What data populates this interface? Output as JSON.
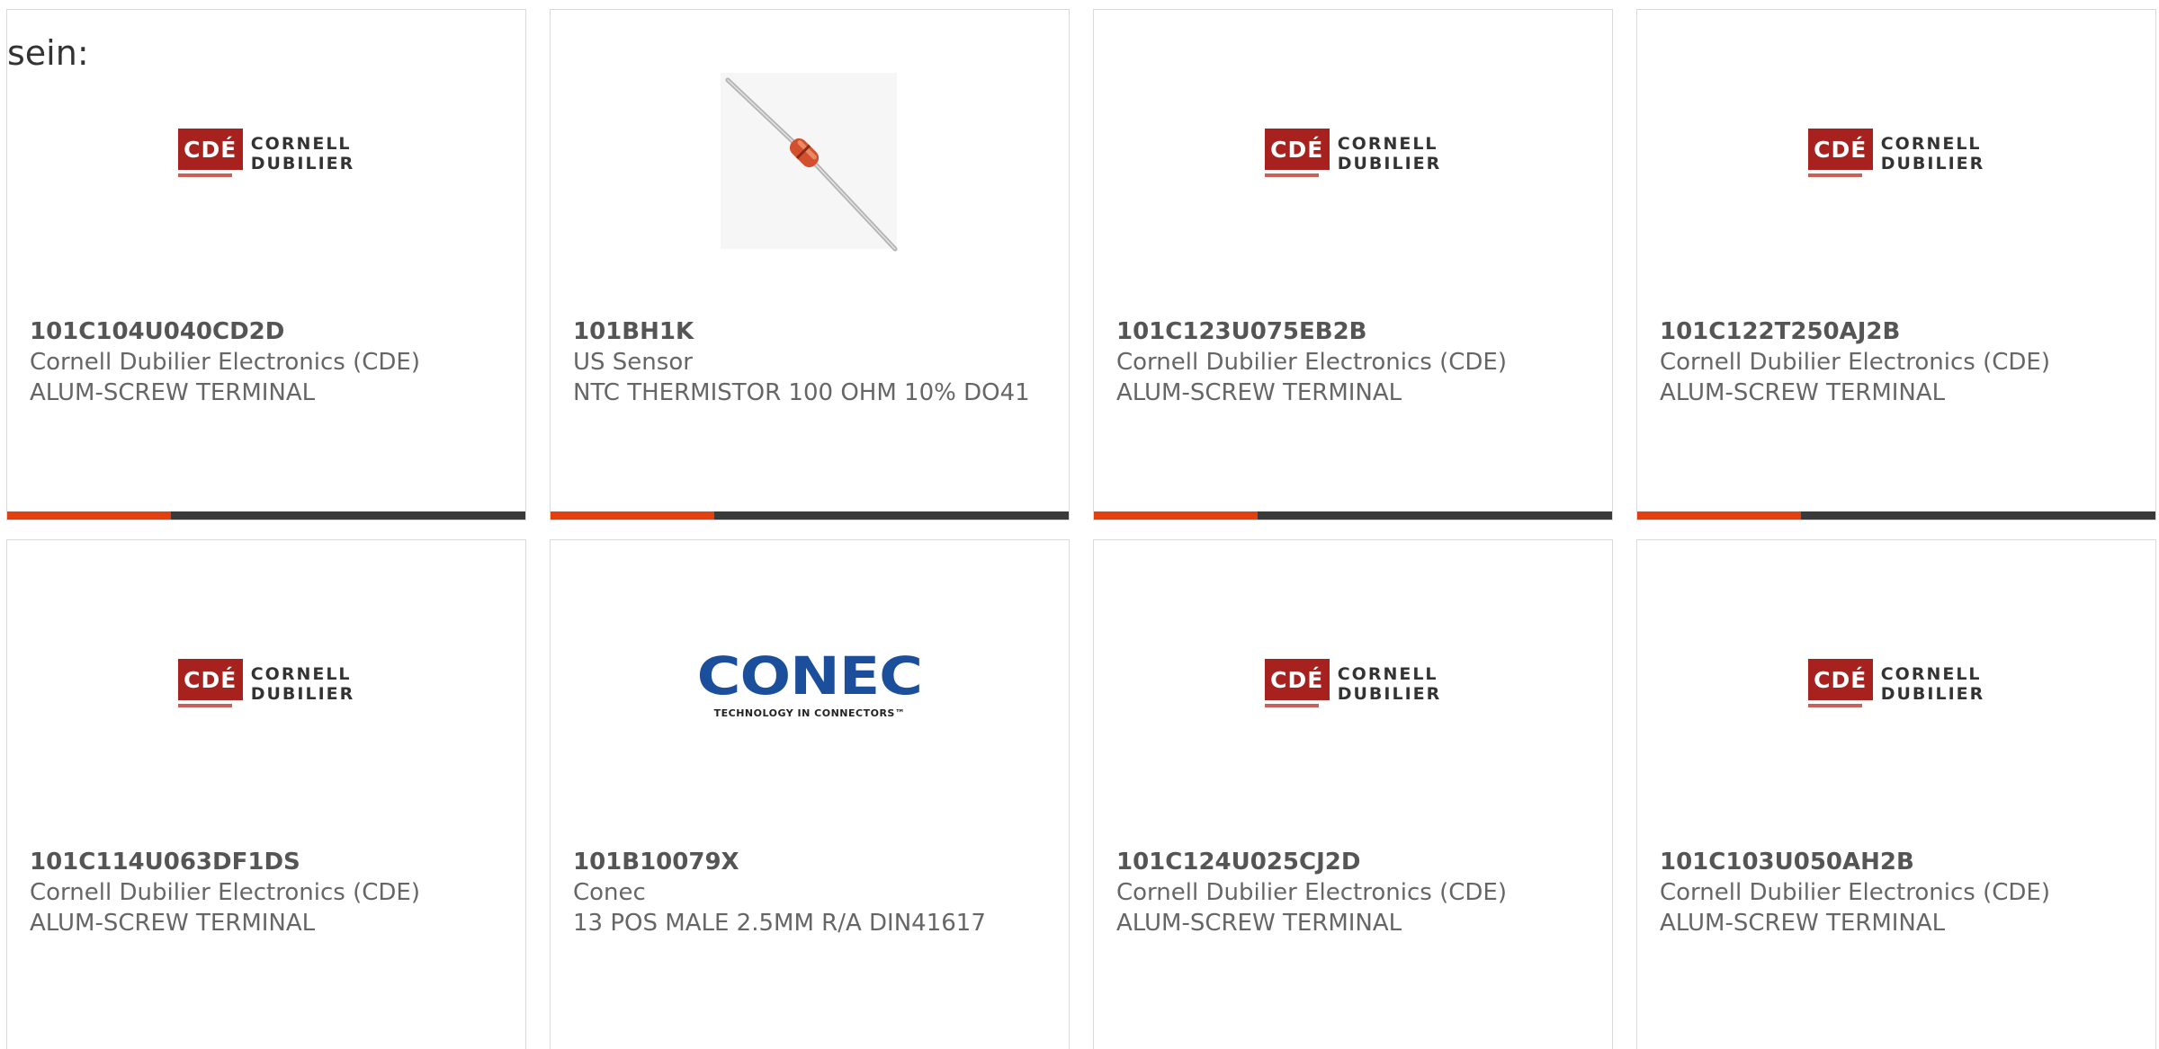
{
  "intro_text": "sein:",
  "logos": {
    "cde": {
      "mark": "CDÉ",
      "line1": "CORNELL",
      "line2": "DUBILIER",
      "color": "#a7211e"
    },
    "conec": {
      "word": "CONEC",
      "tagline": "TECHNOLOGY IN CONNECTORS™",
      "color": "#1b4f9c"
    }
  },
  "colors": {
    "accent": "#e3400f",
    "bar": "#3a3a3a"
  },
  "products": [
    {
      "part_number": "101C104U040CD2D",
      "manufacturer": "Cornell Dubilier Electronics (CDE)",
      "description": "ALUM-SCREW TERMINAL",
      "image": "cornell-dubilier-logo"
    },
    {
      "part_number": "101BH1K",
      "manufacturer": "US Sensor",
      "description": "NTC THERMISTOR 100 OHM 10% DO41",
      "image": "thermistor-photo"
    },
    {
      "part_number": "101C123U075EB2B",
      "manufacturer": "Cornell Dubilier Electronics (CDE)",
      "description": "ALUM-SCREW TERMINAL",
      "image": "cornell-dubilier-logo"
    },
    {
      "part_number": "101C122T250AJ2B",
      "manufacturer": "Cornell Dubilier Electronics (CDE)",
      "description": "ALUM-SCREW TERMINAL",
      "image": "cornell-dubilier-logo"
    },
    {
      "part_number": "101C114U063DF1DS",
      "manufacturer": "Cornell Dubilier Electronics (CDE)",
      "description": "ALUM-SCREW TERMINAL",
      "image": "cornell-dubilier-logo"
    },
    {
      "part_number": "101B10079X",
      "manufacturer": "Conec",
      "description": "13 POS MALE 2.5MM R/A DIN41617",
      "image": "conec-logo"
    },
    {
      "part_number": "101C124U025CJ2D",
      "manufacturer": "Cornell Dubilier Electronics (CDE)",
      "description": "ALUM-SCREW TERMINAL",
      "image": "cornell-dubilier-logo"
    },
    {
      "part_number": "101C103U050AH2B",
      "manufacturer": "Cornell Dubilier Electronics (CDE)",
      "description": "ALUM-SCREW TERMINAL",
      "image": "cornell-dubilier-logo"
    }
  ]
}
